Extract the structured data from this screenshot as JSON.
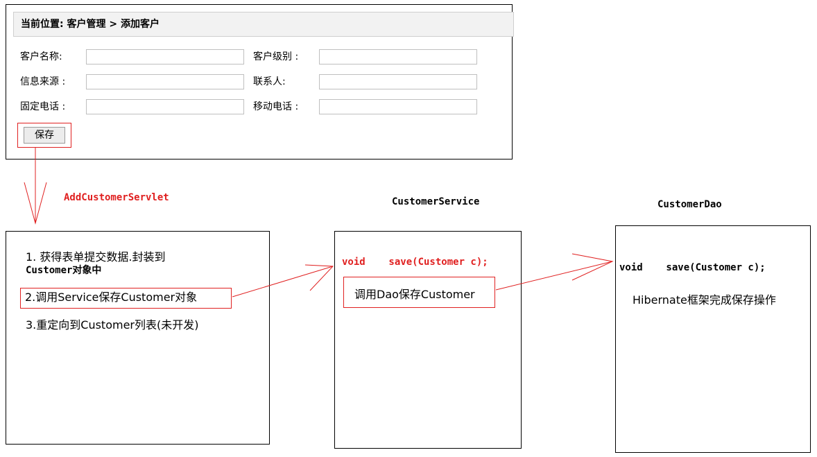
{
  "form": {
    "breadcrumb": "当前位置: 客户管理 > 添加客户",
    "fields": [
      {
        "label": "客户名称:",
        "value": ""
      },
      {
        "label": "客户级别 :",
        "value": ""
      },
      {
        "label": "信息来源 :",
        "value": ""
      },
      {
        "label": "联系人:",
        "value": ""
      },
      {
        "label": "固定电话 :",
        "value": ""
      },
      {
        "label": "移动电话 :",
        "value": ""
      }
    ],
    "save_label": "保存"
  },
  "servlet": {
    "title": "AddCustomerServlet",
    "step1_line1": "1. 获得表单提交数据.封装到",
    "step1_line2": "Customer对象中",
    "step2": "2.调用Service保存Customer对象",
    "step3": "3.重定向到Customer列表(未开发)"
  },
  "service": {
    "title": "CustomerService",
    "method": "void    save(Customer c);",
    "call": "调用Dao保存Customer"
  },
  "dao": {
    "title": "CustomerDao",
    "method": "void    save(Customer c);",
    "note": "Hibernate框架完成保存操作"
  },
  "colors": {
    "accent_red": "#e02020",
    "border": "#000000",
    "header_bg": "#f2f2f2"
  }
}
